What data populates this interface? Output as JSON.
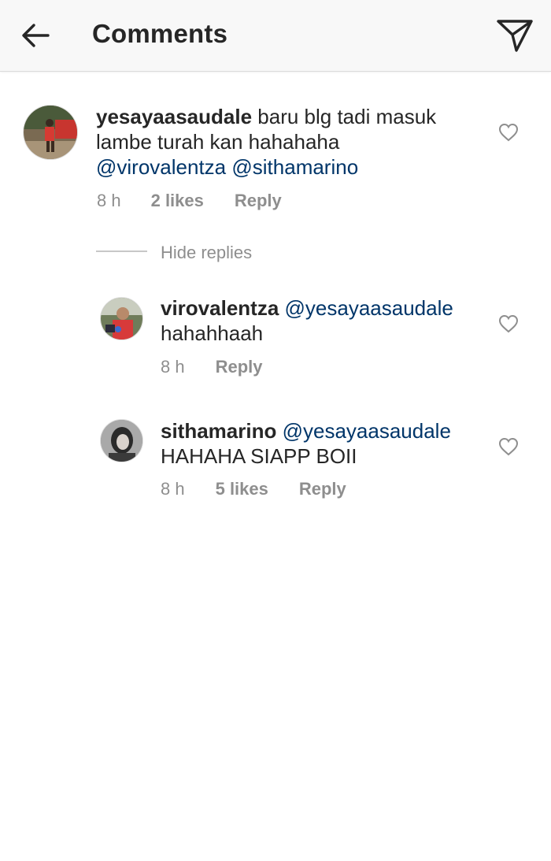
{
  "header": {
    "title": "Comments"
  },
  "comments": [
    {
      "username": "yesayaasaudale",
      "text": " baru blg tadi masuk lambe turah kan hahahaha",
      "mentions": [
        "@virovalentza",
        "@sithamarino"
      ],
      "time": "8 h",
      "likes": "2 likes",
      "reply": "Reply"
    }
  ],
  "hide_replies": "Hide replies",
  "replies": [
    {
      "username": "virovalentza",
      "mention": "@yesayaasaudale",
      "text": "hahahhaah",
      "time": "8 h",
      "reply": "Reply"
    },
    {
      "username": "sithamarino",
      "mention": "@yesayaasaudale",
      "text": "HAHAHA SIAPP BOII",
      "time": "8 h",
      "likes": "5 likes",
      "reply": "Reply"
    }
  ],
  "icons": {
    "back": "arrow-left-icon",
    "send": "paper-plane-icon",
    "like": "heart-outline-icon"
  },
  "colors": {
    "mention": "#003569",
    "meta": "#8e8e8e",
    "text": "#262626",
    "header_bg": "#f8f8f8"
  }
}
